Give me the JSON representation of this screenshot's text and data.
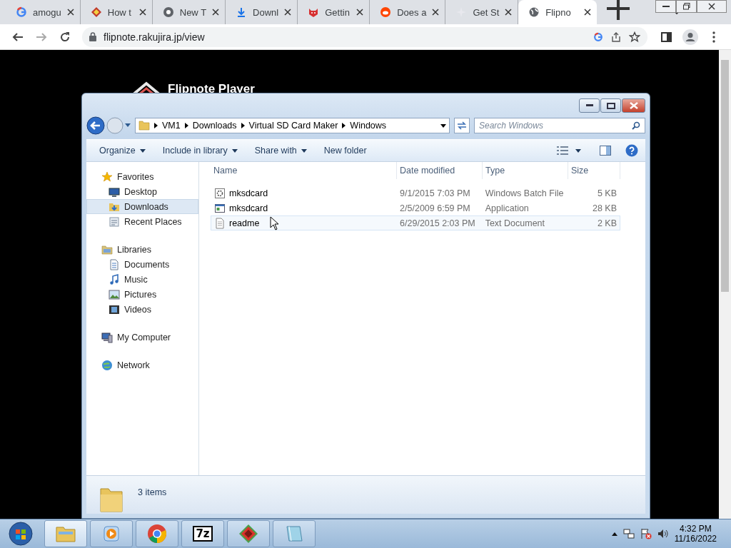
{
  "browser": {
    "tabs": [
      {
        "title": "amogu",
        "kind": "google",
        "selected": false
      },
      {
        "title": "How t",
        "kind": "diamond",
        "selected": false
      },
      {
        "title": "New T",
        "kind": "chrome",
        "selected": false
      },
      {
        "title": "Downl",
        "kind": "download",
        "selected": false
      },
      {
        "title": "Gettin",
        "kind": "cat",
        "selected": false
      },
      {
        "title": "Does a",
        "kind": "reddit",
        "selected": false
      },
      {
        "title": "Get St",
        "kind": "sparkle",
        "selected": false
      },
      {
        "title": "Flipno",
        "kind": "globe",
        "selected": true
      }
    ],
    "address": "flipnote.rakujira.jp/view"
  },
  "page": {
    "heading": "Flipnote Player"
  },
  "explorer": {
    "breadcrumb": [
      "VM1",
      "Downloads",
      "Virtual SD Card Maker",
      "Windows"
    ],
    "search": {
      "placeholder": "Search Windows"
    },
    "toolbar": [
      {
        "label": "Organize",
        "dropdown": true
      },
      {
        "label": "Include in library",
        "dropdown": true
      },
      {
        "label": "Share with",
        "dropdown": true
      },
      {
        "label": "New folder",
        "dropdown": false
      }
    ],
    "nav": [
      {
        "label": "Favorites",
        "kind": "star",
        "children": [
          {
            "label": "Desktop",
            "kind": "desktop",
            "selected": false
          },
          {
            "label": "Downloads",
            "kind": "downloads",
            "selected": true
          },
          {
            "label": "Recent Places",
            "kind": "recent",
            "selected": false
          }
        ]
      },
      {
        "label": "Libraries",
        "kind": "library",
        "children": [
          {
            "label": "Documents",
            "kind": "document",
            "selected": false
          },
          {
            "label": "Music",
            "kind": "music",
            "selected": false
          },
          {
            "label": "Pictures",
            "kind": "pictures",
            "selected": false
          },
          {
            "label": "Videos",
            "kind": "videos",
            "selected": false
          }
        ]
      },
      {
        "label": "My Computer",
        "kind": "computer"
      },
      {
        "label": "Network",
        "kind": "network"
      }
    ],
    "columns": [
      "Name",
      "Date modified",
      "Type",
      "Size"
    ],
    "files": [
      {
        "name": "mksdcard",
        "date": "9/1/2015 7:03 PM",
        "type": "Windows Batch File",
        "size": "5 KB",
        "kind": "batch",
        "selected": false
      },
      {
        "name": "mksdcard",
        "date": "2/5/2009 6:59 PM",
        "type": "Application",
        "size": "28 KB",
        "kind": "app",
        "selected": false
      },
      {
        "name": "readme",
        "date": "6/29/2015 2:03 PM",
        "type": "Text Document",
        "size": "2 KB",
        "kind": "text",
        "selected": true
      }
    ],
    "status": "3 items"
  },
  "taskbar": {
    "apps": [
      {
        "kind": "explorer",
        "active": true
      },
      {
        "kind": "media",
        "active": false
      },
      {
        "kind": "chrome",
        "active": false
      },
      {
        "kind": "sevenzip",
        "label": "7z",
        "active": false
      },
      {
        "kind": "redapp",
        "active": false
      },
      {
        "kind": "notepad",
        "active": false
      }
    ],
    "time": "4:32 PM",
    "date": "11/16/2022"
  }
}
